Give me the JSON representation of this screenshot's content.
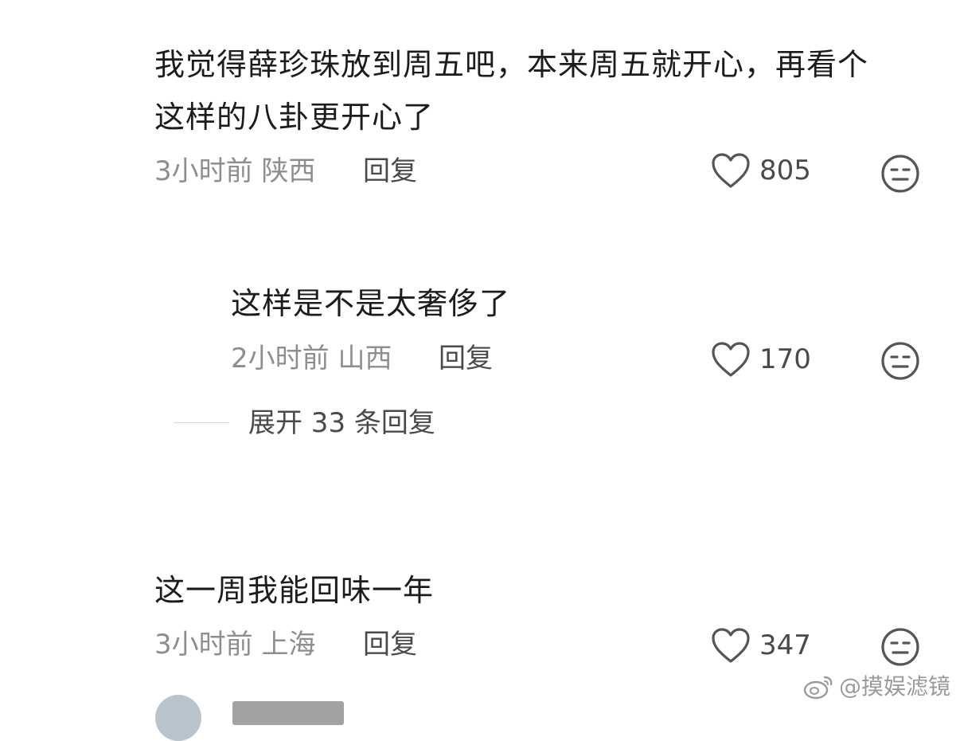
{
  "comments": [
    {
      "text_line1": "我觉得薛珍珠放到周五吧，本来周五就开心，再看个",
      "text_line2": "这样的八卦更开心了",
      "time_location": "3小时前 陕西",
      "reply_label": "回复",
      "likes": "805"
    },
    {
      "text_line1": "这样是不是太奢侈了",
      "time_location": "2小时前 山西",
      "reply_label": "回复",
      "likes": "170"
    },
    {
      "text_line1": "这一周我能回味一年",
      "time_location": "3小时前 上海",
      "reply_label": "回复",
      "likes": "347"
    }
  ],
  "expand_replies_label": "展开 33 条回复",
  "watermark": {
    "text": "@摸娱滤镜",
    "icon": "weibo-icon"
  },
  "icons": {
    "like": "heart-outline-icon",
    "dislike": "meh-face-icon"
  }
}
